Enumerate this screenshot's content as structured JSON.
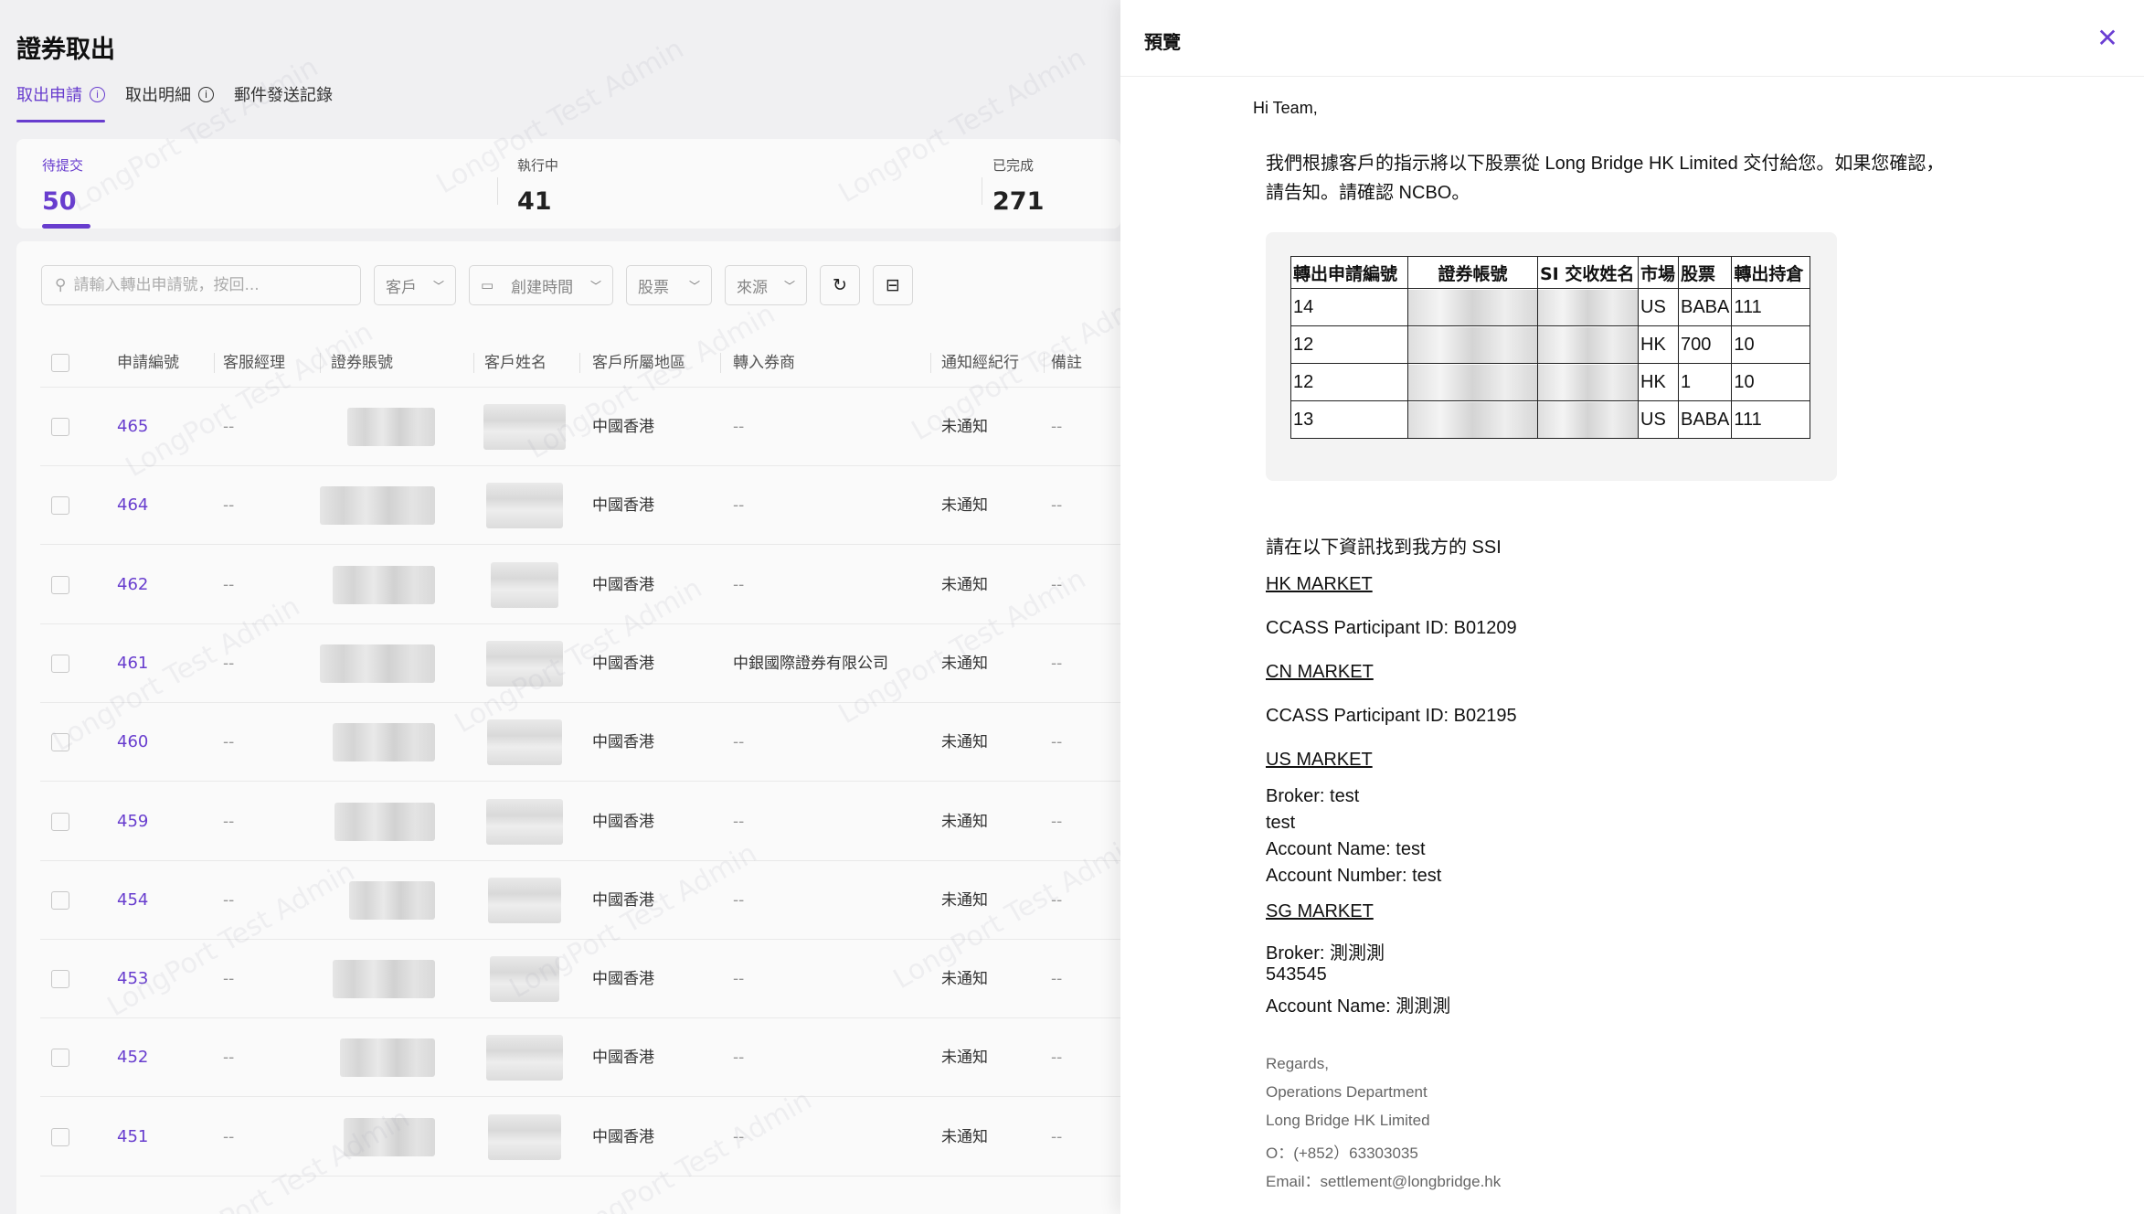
{
  "page": {
    "title": "證券取出"
  },
  "tabs": [
    {
      "label": "取出申請",
      "has_info": true,
      "active": true
    },
    {
      "label": "取出明細",
      "has_info": true,
      "active": false
    },
    {
      "label": "郵件發送記錄",
      "has_info": false,
      "active": false
    }
  ],
  "stats": [
    {
      "label": "待提交",
      "value": "50",
      "active": true
    },
    {
      "label": "執行中",
      "value": "41",
      "active": false
    },
    {
      "label": "已完成",
      "value": "271",
      "active": false
    }
  ],
  "filters": {
    "search_placeholder": "請輸入轉出申請號，按回...",
    "customer": "客戶",
    "created_time": "創建時間",
    "stock": "股票",
    "source": "來源"
  },
  "table": {
    "headers": [
      "申請編號",
      "客服經理",
      "證券賬號",
      "客戶姓名",
      "客戶所屬地區",
      "轉入券商",
      "通知經紀行",
      "備註"
    ],
    "rows": [
      {
        "id": "465",
        "manager": "--",
        "region": "中國香港",
        "broker": "--",
        "notify": "未通知",
        "note": "--"
      },
      {
        "id": "464",
        "manager": "--",
        "region": "中國香港",
        "broker": "--",
        "notify": "未通知",
        "note": "--"
      },
      {
        "id": "462",
        "manager": "--",
        "region": "中國香港",
        "broker": "--",
        "notify": "未通知",
        "note": "--"
      },
      {
        "id": "461",
        "manager": "--",
        "region": "中國香港",
        "broker": "中銀國際證券有限公司",
        "notify": "未通知",
        "note": "--"
      },
      {
        "id": "460",
        "manager": "--",
        "region": "中國香港",
        "broker": "--",
        "notify": "未通知",
        "note": "--"
      },
      {
        "id": "459",
        "manager": "--",
        "region": "中國香港",
        "broker": "--",
        "notify": "未通知",
        "note": "--"
      },
      {
        "id": "454",
        "manager": "--",
        "region": "中國香港",
        "broker": "--",
        "notify": "未通知",
        "note": "--"
      },
      {
        "id": "453",
        "manager": "--",
        "region": "中國香港",
        "broker": "--",
        "notify": "未通知",
        "note": "--"
      },
      {
        "id": "452",
        "manager": "--",
        "region": "中國香港",
        "broker": "--",
        "notify": "未通知",
        "note": "--"
      },
      {
        "id": "451",
        "manager": "--",
        "region": "中國香港",
        "broker": "--",
        "notify": "未通知",
        "note": "--"
      }
    ]
  },
  "watermark": "LongPort Test Admin",
  "drawer": {
    "title": "預覽",
    "email": {
      "greeting": "Hi Team,",
      "intro_line1": "我們根據客戶的指示將以下股票從 Long Bridge HK Limited 交付給您。如果您確認，",
      "intro_line2": "請告知。請確認 NCBO。",
      "table_headers": [
        "轉出申請編號",
        "證券帳號",
        "SI 交收姓名",
        "市場",
        "股票",
        "轉出持倉"
      ],
      "table_rows": [
        {
          "id": "14",
          "market": "US",
          "stock": "BABA",
          "qty": "111"
        },
        {
          "id": "12",
          "market": "HK",
          "stock": "700",
          "qty": "10"
        },
        {
          "id": "12",
          "market": "HK",
          "stock": "1",
          "qty": "10"
        },
        {
          "id": "13",
          "market": "US",
          "stock": "BABA",
          "qty": "111"
        }
      ],
      "ssi_title": "請在以下資訊找到我方的 SSI",
      "hk_market": "HK MARKET",
      "hk_ccass": "CCASS Participant ID: B01209",
      "cn_market": "CN MARKET",
      "cn_ccass": "CCASS Participant ID: B02195",
      "us_market": "US MARKET",
      "us_broker": "Broker: test",
      "us_line2": "test",
      "us_account_name": "Account Name: test",
      "us_account_number": "Account Number: test",
      "sg_market": "SG MARKET",
      "sg_broker": "Broker: 測測測",
      "sg_line2": "543545",
      "sg_account_name": "Account Name: 測測測",
      "sig_regards": "Regards,",
      "sig_dept": "Operations Department",
      "sig_company": "Long Bridge HK Limited",
      "sig_phone": "O：(+852）63303035",
      "sig_email": "Email：settlement@longbridge.hk"
    }
  },
  "colors": {
    "accent": "#6b3fd3"
  }
}
